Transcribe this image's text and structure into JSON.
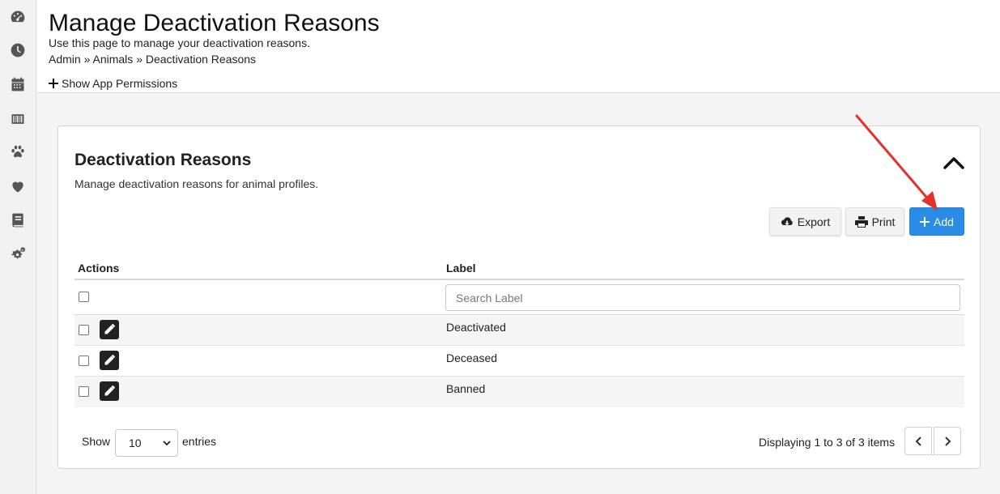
{
  "sidebar": {
    "items": [
      {
        "icon": "dashboard-icon"
      },
      {
        "icon": "clock-icon"
      },
      {
        "icon": "calendar-icon"
      },
      {
        "icon": "barcode-icon"
      },
      {
        "icon": "paw-icon"
      },
      {
        "icon": "heart-icon"
      },
      {
        "icon": "book-icon"
      },
      {
        "icon": "gears-icon"
      }
    ]
  },
  "header": {
    "title": "Manage Deactivation Reasons",
    "description": "Use this page to manage your deactivation reasons.",
    "breadcrumb": [
      "Admin",
      "Animals",
      "Deactivation Reasons"
    ],
    "breadcrumb_sep": "»",
    "permissions_toggle": "Show App Permissions"
  },
  "card": {
    "title": "Deactivation Reasons",
    "description": "Manage deactivation reasons for animal profiles.",
    "buttons": {
      "export": "Export",
      "print": "Print",
      "add": "Add"
    },
    "accent_color": "#2b8ce8"
  },
  "table": {
    "columns": [
      "Actions",
      "Label"
    ],
    "search_placeholder": "Search Label",
    "rows": [
      {
        "label": "Deactivated"
      },
      {
        "label": "Deceased"
      },
      {
        "label": "Banned"
      }
    ]
  },
  "footer": {
    "show_label": "Show",
    "entries_value": "10",
    "entries_label": "entries",
    "pagination_text": "Displaying 1 to 3 of 3 items"
  },
  "annotation": {
    "arrow_color": "#e8302a",
    "points_to": "add-button"
  }
}
